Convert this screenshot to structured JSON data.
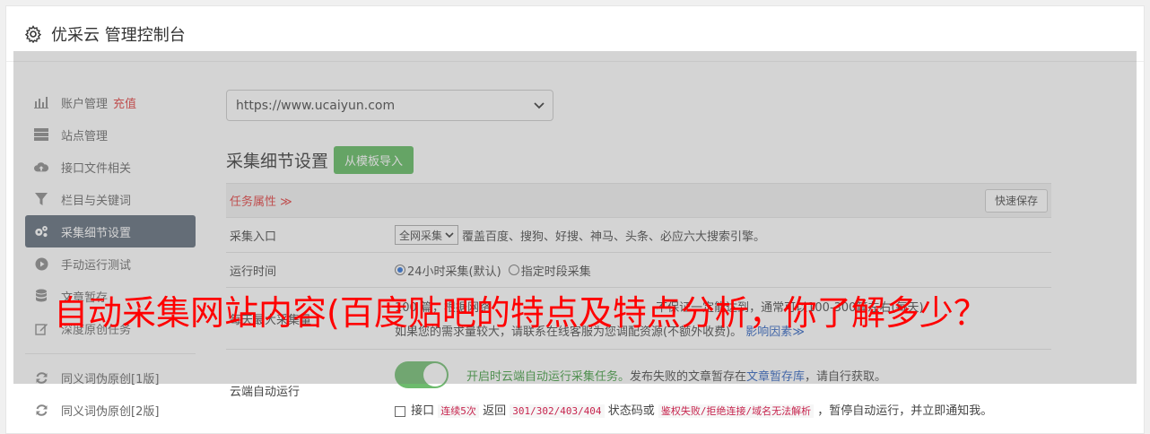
{
  "header": {
    "title": "优采云 管理控制台",
    "icon": "gear-icon"
  },
  "sidebar": {
    "items": [
      {
        "label": "账户管理",
        "extra": "充值",
        "icon": "bar-chart-icon"
      },
      {
        "label": "站点管理",
        "icon": "server-icon"
      },
      {
        "label": "接口文件相关",
        "icon": "cloud-upload-icon"
      },
      {
        "label": "栏目与关键词",
        "icon": "filter-icon"
      },
      {
        "label": "采集细节设置",
        "icon": "gears-icon",
        "active": true
      },
      {
        "label": "手动运行测试",
        "icon": "play-circle-icon"
      },
      {
        "label": "文章暂存",
        "icon": "database-icon"
      },
      {
        "label": "深度原创任务",
        "icon": "edit-icon"
      },
      {
        "label": "同义词伪原创[1版]",
        "icon": "refresh-icon"
      },
      {
        "label": "同义词伪原创[2版]",
        "icon": "refresh-icon"
      }
    ]
  },
  "main": {
    "site_select_value": "https://www.ucaiyun.com",
    "section_title": "采集细节设置",
    "import_button": "从模板导入",
    "task_attr_label": "任务属性",
    "quick_save": "快速保存",
    "rows": {
      "entry": {
        "label": "采集入口",
        "select": "全网采集",
        "desc": "覆盖百度、搜狗、好搜、神马、头条、必应六大搜索引擎。"
      },
      "runtime": {
        "label": "运行时间",
        "opt1": "24小时采集(默认)",
        "opt2": "指定时段采集"
      },
      "max": {
        "label": "每天最大采集量",
        "line1_a": "100",
        "line1_b": "篇，根据网络",
        "line1_c": "不保证一定能达到，通常可以100-300篇左右(每天)",
        "line2": "如果您的需求量较大，请联系在线客服为您调配资源(不额外收费)。",
        "line2_link": "影响因素"
      },
      "cloud": {
        "label": "云端自动运行",
        "desc_green": "开启时云端自动运行采集任务。",
        "desc_rest": "发布失败的文章暂存在",
        "desc_link": "文章暂存库",
        "desc_tail": "，请自行获取。",
        "chk_a": "接口",
        "code1": "连续5次",
        "chk_b": "返回",
        "code2": "301/302/403/404",
        "chk_c": "状态码或",
        "code3": "鉴权失败/拒绝连接/域名无法解析",
        "chk_d": "，暂停自动运行，并立即通知我。"
      }
    }
  },
  "watermark_text": "自动采集网站内容(百度贴吧的特点及特点分析，你了解多少？"
}
